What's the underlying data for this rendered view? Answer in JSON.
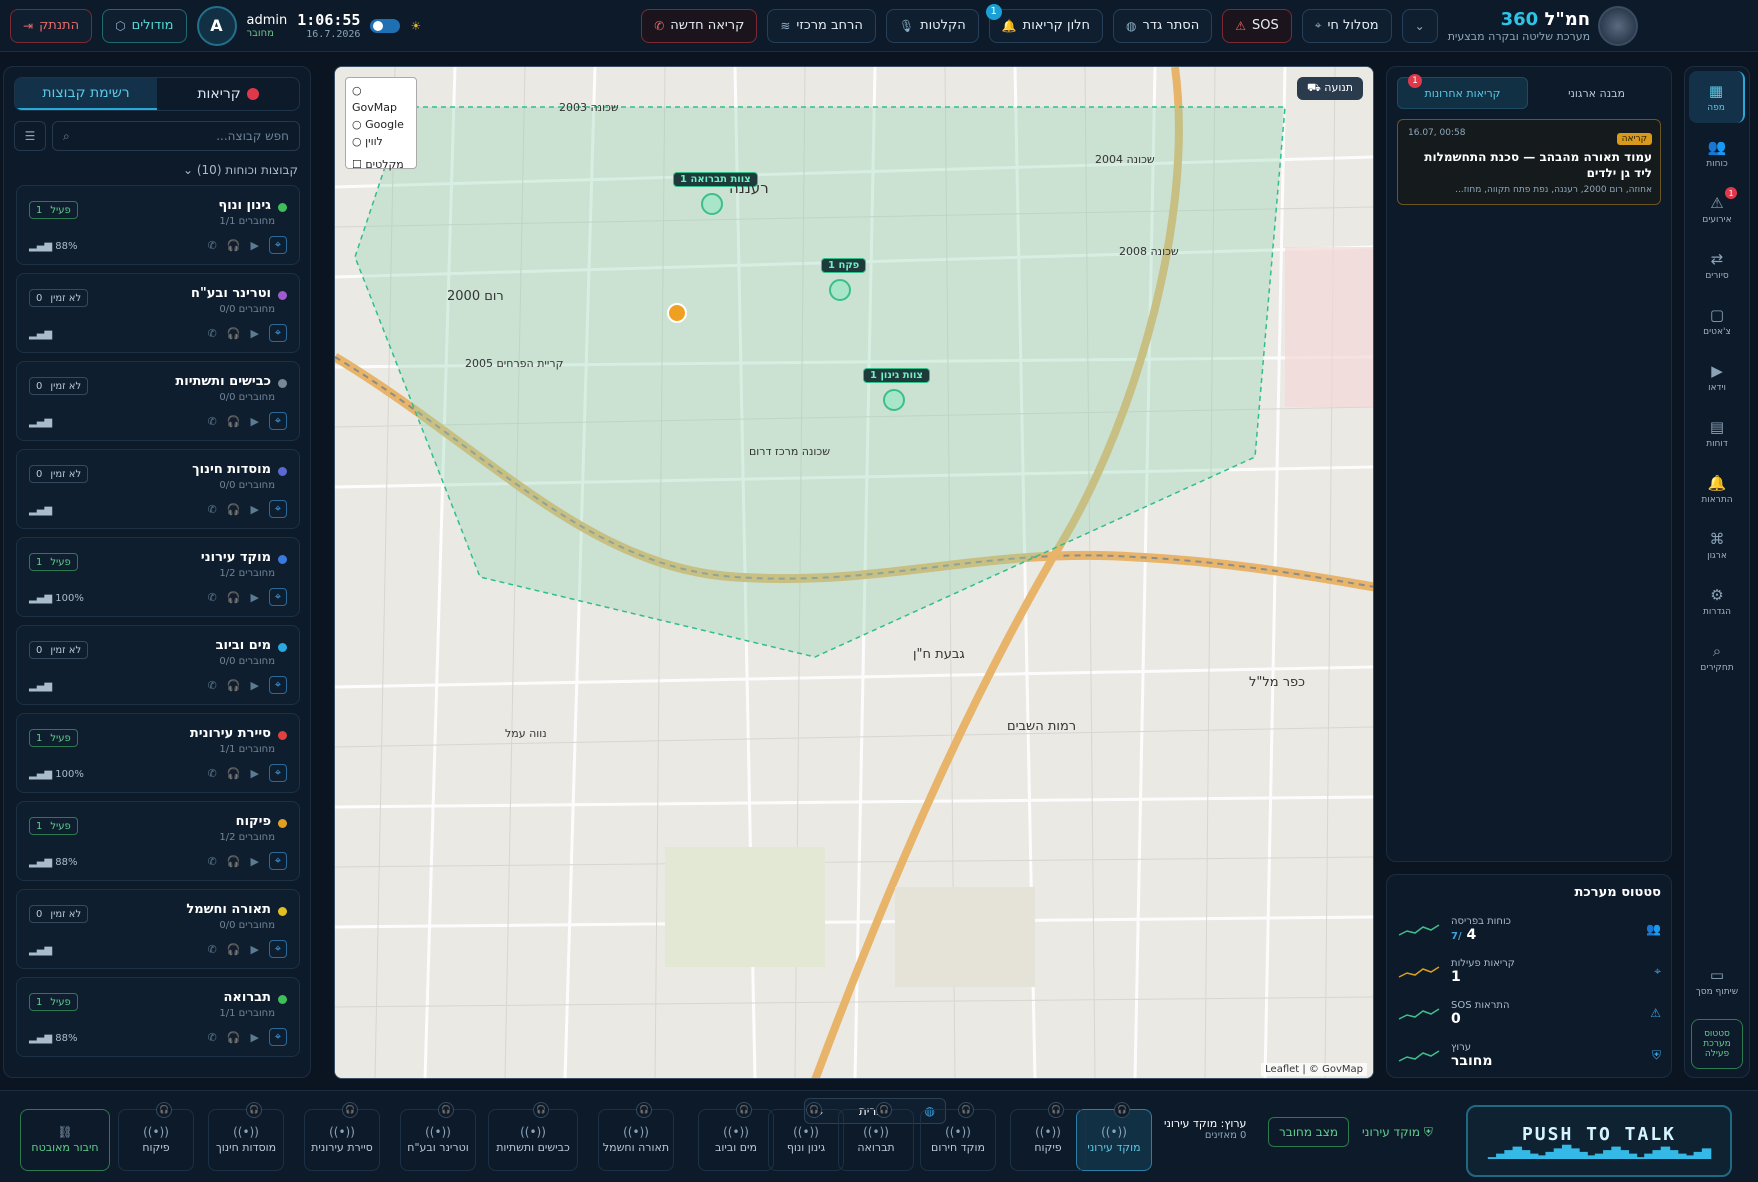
{
  "header": {
    "app_title": "חמ\"ל",
    "app_title_num": "360",
    "app_subtitle": "מערכת שליטה ובקרה מבצעית",
    "route_btn": "מסלול חי",
    "sos_btn": "SOS",
    "hide_fence_btn": "הסתר גדר",
    "calls_window_btn": "חלון קריאות",
    "calls_badge": "1",
    "recordings_btn": "הקלטות",
    "central_expand_btn": "הרחב מרכזי",
    "new_call_btn": "קריאה חדשה",
    "clock": "1:06:55",
    "date": "16.7.2026",
    "user_name": "admin",
    "user_status": "מחובר",
    "avatar_letter": "A",
    "modules_btn": "מודולים",
    "logout_btn": "התנתק"
  },
  "left": {
    "tab_calls": "קריאות",
    "tab_groups": "רשימת קבוצות",
    "search_placeholder": "חפש קבוצה...",
    "groups_header": "קבוצות וכוחות (10)",
    "groups": [
      {
        "name": "גינון ונוף",
        "sub": "מחוברים 1/1",
        "status": "פעיל",
        "count": "1",
        "bat": "88%",
        "color": "#3fbf5a",
        "active": true
      },
      {
        "name": "וטרינר ובע\"ח",
        "sub": "מחוברים 0/0",
        "status": "לא זמין",
        "count": "0",
        "bat": "",
        "color": "#a05ad0",
        "active": false
      },
      {
        "name": "כבישים ותשתיות",
        "sub": "מחוברים 0/0",
        "status": "לא זמין",
        "count": "0",
        "bat": "",
        "color": "#7a8896",
        "active": false
      },
      {
        "name": "מוסדות חינוך",
        "sub": "מחוברים 0/0",
        "status": "לא זמין",
        "count": "0",
        "bat": "",
        "color": "#5a6ad0",
        "active": false
      },
      {
        "name": "מוקד עירוני",
        "sub": "מחוברים 1/2",
        "status": "פעיל",
        "count": "1",
        "bat": "100%",
        "color": "#3a7ae0",
        "active": true
      },
      {
        "name": "מים וביוב",
        "sub": "מחוברים 0/0",
        "status": "לא זמין",
        "count": "0",
        "bat": "",
        "color": "#2aa8e0",
        "active": false
      },
      {
        "name": "סיירת עירונית",
        "sub": "מחוברים 1/1",
        "status": "פעיל",
        "count": "1",
        "bat": "100%",
        "color": "#e04040",
        "active": true
      },
      {
        "name": "פיקוח",
        "sub": "מחוברים 1/2",
        "status": "פעיל",
        "count": "1",
        "bat": "88%",
        "color": "#e0a020",
        "active": true
      },
      {
        "name": "תאורה וחשמל",
        "sub": "מחוברים 0/0",
        "status": "לא זמין",
        "count": "0",
        "bat": "",
        "color": "#e0c020",
        "active": false
      },
      {
        "name": "תברואה",
        "sub": "מחוברים 1/1",
        "status": "פעיל",
        "count": "1",
        "bat": "88%",
        "color": "#3fbf5a",
        "active": true
      }
    ]
  },
  "map": {
    "layer_govmap": "GovMap",
    "layer_google": "Google",
    "layer_lavin": "לווין",
    "layer_clusters": "מקלטים",
    "traffic_btn": "תנועה",
    "attribution": "Leaflet | © GovMap",
    "markers": [
      "צוות תברואה 1",
      "פקח 1",
      "צוות גינון 1"
    ],
    "labels": [
      "רעננה",
      "רום 2000",
      "שכונה מרכז דרום",
      "גבעת ח\"ן",
      "רמות השבים",
      "כפר מל\"ל",
      "נווה עמל",
      "קריית הפרחים 2005",
      "שכונה 2003",
      "שכונה 2004",
      "שכונה 2008"
    ]
  },
  "right": {
    "tab_org": "מבנה ארגוני",
    "tab_recent": "קריאות אחרונות",
    "tab_recent_badge": "1",
    "alert_tag": "קריאה",
    "alert_time": "16.07, 00:58",
    "alert_title": "עמוד תאורה מהבהב — סכנת התחשמלות ליד גן ילדים",
    "alert_addr": "אחוזה, רום 2000, רעננה, נפת פתח תקווה, מחוז...",
    "sys_title": "סטטוס מערכת",
    "stats": [
      {
        "label": "כוחות בפריסה",
        "value": "4",
        "extra": "/7"
      },
      {
        "label": "קריאות פעילות",
        "value": "1",
        "extra": ""
      },
      {
        "label": "התראות SOS",
        "value": "0",
        "extra": ""
      },
      {
        "label": "ערוץ",
        "value": "מחובר",
        "extra": ""
      }
    ]
  },
  "rail": {
    "items": [
      "מפה",
      "כוחות",
      "אירועים",
      "סיורים",
      "צ'אטים",
      "וידאו",
      "דוחות",
      "התראות",
      "ארגון",
      "הגדרות",
      "תחקירים"
    ],
    "events_badge": "1",
    "share_screen": "שיתוף מסך",
    "sys_status": "סטטוס מערכת פעילה"
  },
  "bottom": {
    "ptt": "PUSH TO TALK",
    "city_center_chip": "מוקד עירוני",
    "connected_chip": "מצב מחובר",
    "channel_label": "ערוץ: מוקד עירוני",
    "listeners": "0 מאזינים",
    "language": "עברית",
    "channels": [
      "מוקד עירוני",
      "פיקוח",
      "מוקד חירום",
      "תברואה",
      "גינון ונוף",
      "מים וביוב",
      "תאורה וחשמל",
      "כבישים ותשתיות",
      "וטרינר ובע\"ח",
      "סיירת עירונית",
      "מוסדות חינוך",
      "פיקוח"
    ],
    "ambulance": "חיבור מאובטח"
  }
}
